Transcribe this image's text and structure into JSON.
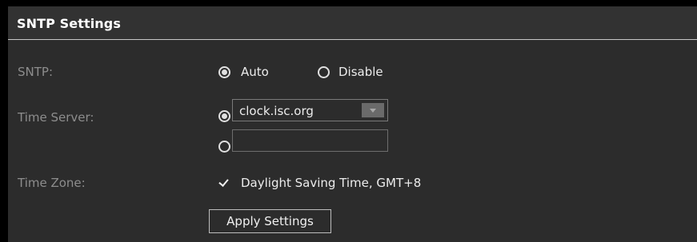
{
  "panel": {
    "title": "SNTP Settings"
  },
  "sntp": {
    "label": "SNTP:",
    "options": [
      {
        "label": "Auto",
        "selected": true
      },
      {
        "label": "Disable",
        "selected": false
      }
    ]
  },
  "time_server": {
    "label": "Time Server:",
    "select": {
      "selected": true,
      "value": "clock.isc.org",
      "icon": "chevron-down-icon"
    },
    "custom": {
      "selected": false,
      "value": "",
      "placeholder": ""
    }
  },
  "time_zone": {
    "label": "Time Zone:",
    "checkbox_checked": true,
    "value": "Daylight Saving Time, GMT+8"
  },
  "apply_button": {
    "label": "Apply Settings"
  },
  "colors": {
    "page_background": "#000000",
    "panel_background": "#2c2c2c",
    "label_text": "#8d8d8d",
    "value_text": "#ececec"
  }
}
